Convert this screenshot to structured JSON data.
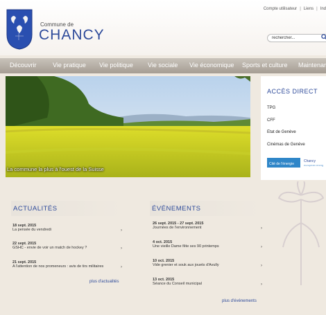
{
  "header": {
    "commune_small": "Commune de",
    "commune_name": "CHANCY",
    "top_links": [
      "Compte utilisateur",
      "Liens",
      "Ind"
    ],
    "search_placeholder": "rechercher..."
  },
  "nav": {
    "items": [
      "Découvrir",
      "Vie pratique",
      "Vie politique",
      "Vie sociale",
      "Vie économique",
      "Sports et culture",
      "Maintenar"
    ]
  },
  "hero": {
    "caption": "La commune la plus à l'ouest de la Suisse"
  },
  "acces_direct": {
    "title": "ACCÈS DIRECT",
    "links": [
      "TPG",
      "CFF",
      "Etat de Genève",
      "Cinémas de Genève"
    ],
    "logo_label": "Cité de l'énergie",
    "logo_name": "Chancy",
    "logo_sub": "european energ"
  },
  "actualites": {
    "title": "ACTUALITÉS",
    "items": [
      {
        "date": "18 sept. 2015",
        "title": "La pensée du vendredi"
      },
      {
        "date": "22 sept. 2015",
        "title": "GSHC - envie de voir un match de hockey ?"
      },
      {
        "date": "21 sept. 2015",
        "title": "A l'attention de nos promeneurs : avis de tirs militaires"
      }
    ],
    "more": "plus d'actualités"
  },
  "evenements": {
    "title": "ÉVÉNEMENTS",
    "items": [
      {
        "date": "26 sept. 2015 - 27 sept. 2015",
        "title": "Journées de l'environnement"
      },
      {
        "date": "4 oct. 2015",
        "title": "Une vieille Dame fête ses 90 printemps"
      },
      {
        "date": "10 oct. 2015",
        "title": "Vide grenier et souk aux jouets d'Avully"
      },
      {
        "date": "13 oct. 2015",
        "title": "Séance du Conseil municipal"
      }
    ],
    "more": "plus d'événements"
  },
  "icons": {
    "search": "search-icon",
    "arrow": "chevron-right-icon",
    "crest": "coat-of-arms-icon"
  },
  "colors": {
    "brand": "#2d4a9a",
    "nav": "#b3aca3",
    "background": "#efe9e0"
  }
}
